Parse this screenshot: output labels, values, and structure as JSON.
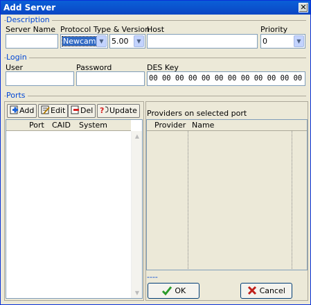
{
  "window": {
    "title": "Add Server",
    "close_glyph": "✕"
  },
  "description": {
    "group_label": "Description",
    "server_name_label": "Server Name",
    "server_name_value": "",
    "protocol_label": "Protocol Type & Version",
    "protocol_value": "Newcamd",
    "version_value": "5.00",
    "host_label": "Host",
    "host_value": "",
    "priority_label": "Priority",
    "priority_value": "0"
  },
  "login": {
    "group_label": "Login",
    "user_label": "User",
    "user_value": "",
    "password_label": "Password",
    "password_value": "",
    "des_key_label": "DES Key",
    "des_key_value": "00 00 00 00 00 00 00 00 00 00 00 00 00 00"
  },
  "ports": {
    "group_label": "Ports",
    "toolbar": {
      "add_label": "Add",
      "edit_label": "Edit",
      "del_label": "Del",
      "update_label": "Update"
    },
    "columns": [
      "Port",
      "CAID",
      "System"
    ],
    "rows": []
  },
  "providers": {
    "title": "Providers on selected port",
    "columns": [
      "Provider",
      "Name"
    ],
    "rows": [],
    "status_text": "----"
  },
  "buttons": {
    "ok_label": "OK",
    "cancel_label": "Cancel"
  },
  "colors": {
    "title_bar": "#0a5fd8",
    "group_label": "#0046d5",
    "face": "#ece9d8"
  },
  "icons": [
    "close-icon",
    "chevron-down-icon",
    "add-icon",
    "edit-icon",
    "delete-icon",
    "update-icon",
    "check-icon",
    "cancel-x-icon"
  ]
}
